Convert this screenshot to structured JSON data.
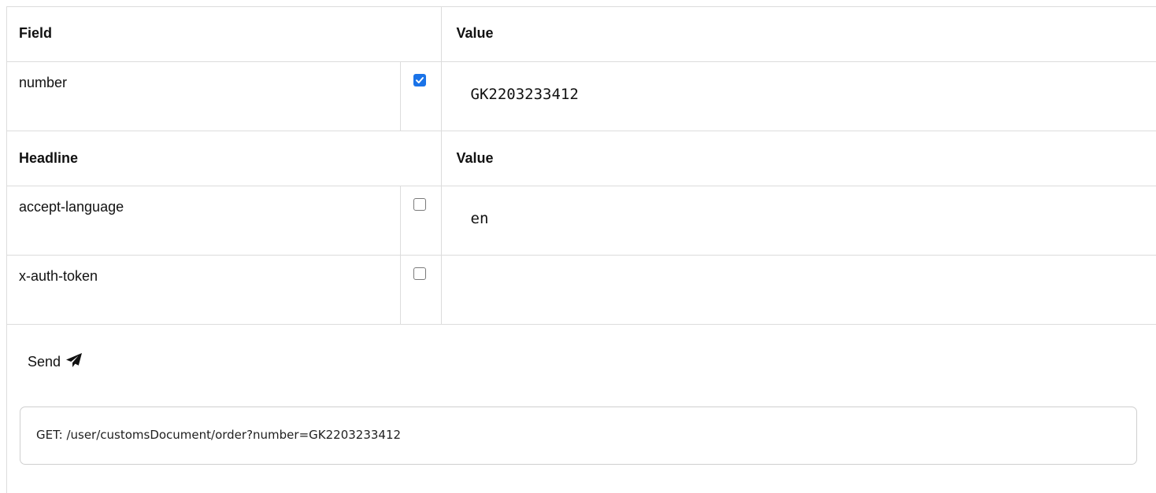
{
  "fields_table": {
    "header_field": "Field",
    "header_value": "Value",
    "rows": [
      {
        "name": "number",
        "checked": true,
        "value": "GK2203233412"
      }
    ]
  },
  "headers_table": {
    "header_field": "Headline",
    "header_value": "Value",
    "rows": [
      {
        "name": "accept-language",
        "checked": false,
        "value": "en"
      },
      {
        "name": "x-auth-token",
        "checked": false,
        "value": ""
      }
    ]
  },
  "send_button": {
    "label": "Send",
    "icon": "paper-plane-icon"
  },
  "request_preview": {
    "text": "GET: /user/customsDocument/order?number=GK2203233412"
  },
  "colors": {
    "checkbox_checked": "#1a73e8",
    "border": "#dcdcdc"
  }
}
